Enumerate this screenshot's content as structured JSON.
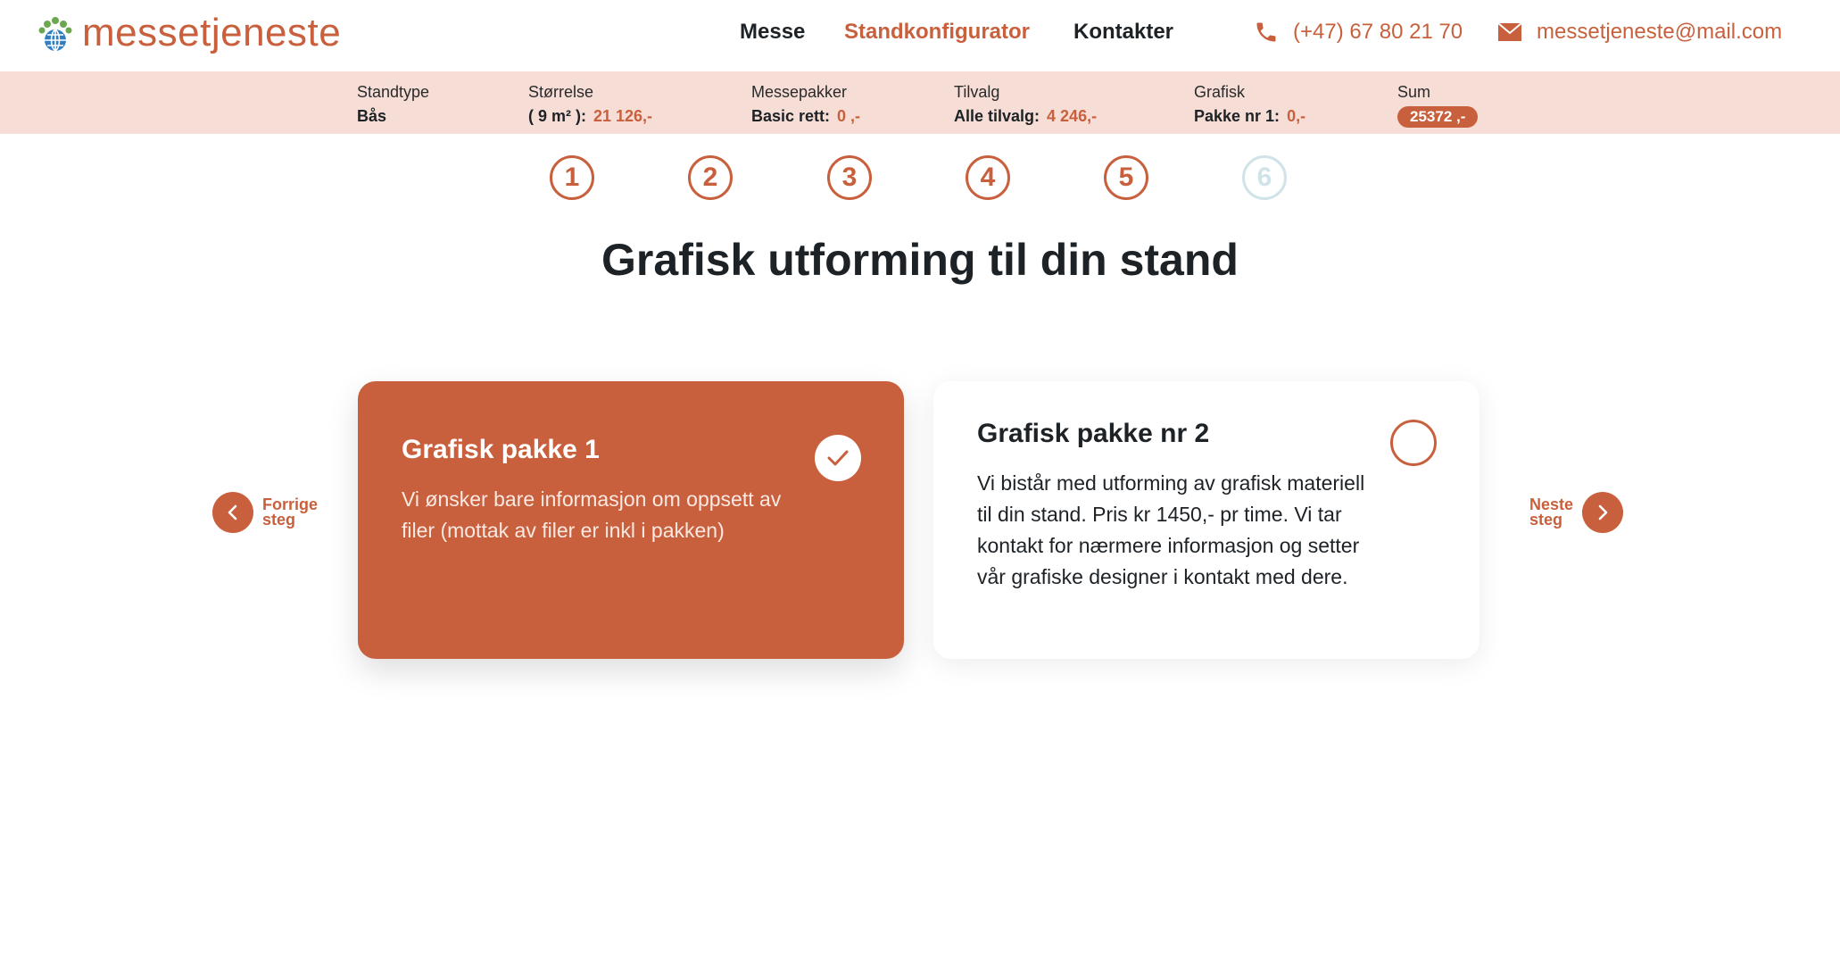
{
  "brand": {
    "name": "messetjeneste",
    "accent": "#c9603d",
    "summary_bg": "#f6ddd5"
  },
  "nav": {
    "items": [
      {
        "label": "Messe"
      },
      {
        "label": "Standkonfigurator"
      },
      {
        "label": "Kontakter"
      }
    ],
    "phone": "(+47) 67 80 21 70",
    "email": "messetjeneste@mail.com"
  },
  "summary": {
    "standtype": {
      "label": "Standtype",
      "value": "Bås"
    },
    "size": {
      "label": "Størrelse",
      "value": "( 9 m² ):",
      "price": "21 126,-"
    },
    "packages": {
      "label": "Messepakker",
      "value": "Basic rett:",
      "price": "0 ,-"
    },
    "extras": {
      "label": "Tilvalg",
      "value": "Alle tilvalg:",
      "price": "4 246,-"
    },
    "graphic": {
      "label": "Grafisk",
      "value": "Pakke nr 1:",
      "price": "0,-"
    },
    "sum": {
      "label": "Sum",
      "value": "25372 ,-"
    }
  },
  "steps": [
    "1",
    "2",
    "3",
    "4",
    "5",
    "6"
  ],
  "title": "Grafisk utforming til din stand",
  "cards": [
    {
      "title": "Grafisk pakke 1",
      "description": "Vi ønsker bare informasjon om oppsett av filer (mottak av filer er inkl i pakken)"
    },
    {
      "title": "Grafisk pakke nr 2",
      "description": "Vi bistår med utforming av grafisk materiell til din stand. Pris kr 1450,- pr time. Vi tar kontakt for nærmere informasjon og setter vår grafiske designer i kontakt med dere."
    }
  ],
  "prev": {
    "line1": "Forrige",
    "line2": "steg"
  },
  "next": {
    "line1": "Neste",
    "line2": "steg"
  }
}
